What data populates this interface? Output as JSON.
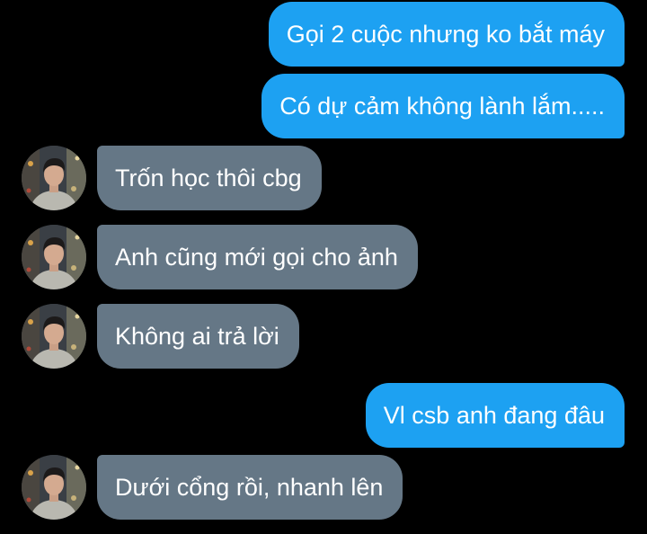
{
  "messages": [
    {
      "sender": "me",
      "text": "Gọi 2 cuộc nhưng ko bắt máy"
    },
    {
      "sender": "me",
      "text": "Có dự cảm không lành lắm....."
    },
    {
      "sender": "contact",
      "text": "Trốn học thôi cbg"
    },
    {
      "sender": "contact",
      "text": "Anh cũng mới gọi cho ảnh"
    },
    {
      "sender": "contact",
      "text": "Không ai trả lời"
    },
    {
      "sender": "me",
      "text": "Vl csb anh đang đâu"
    },
    {
      "sender": "contact",
      "text": "Dưới cổng rồi, nhanh lên"
    }
  ],
  "colors": {
    "background": "#000000",
    "sent_bubble": "#1da1f2",
    "received_bubble": "#657786",
    "text": "#ffffff"
  },
  "icons": {
    "avatar": "contact-avatar-photo"
  }
}
